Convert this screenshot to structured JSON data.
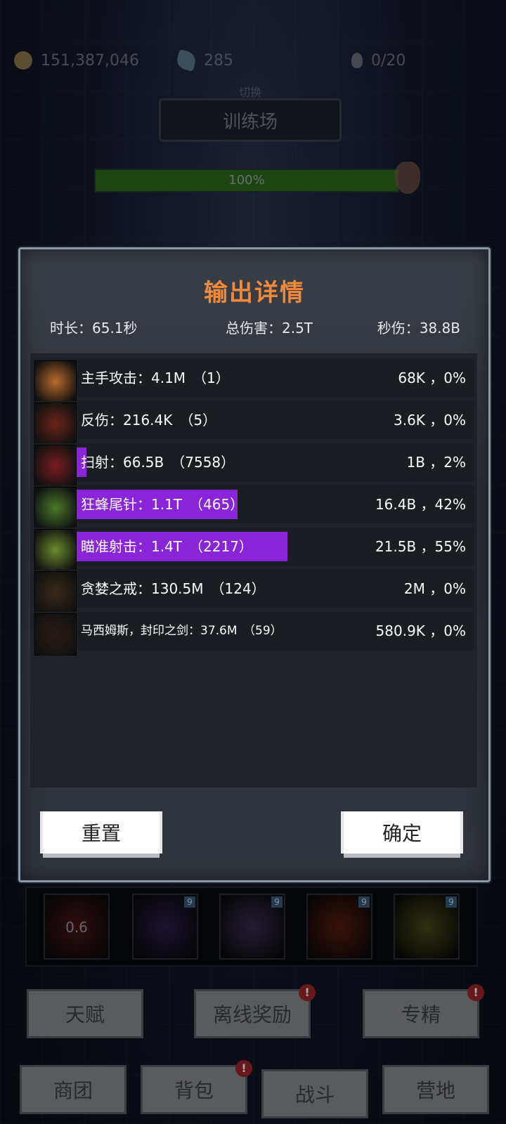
{
  "resources": {
    "gold": "151,387,046",
    "gems": "285",
    "stamina": "0/20"
  },
  "scene": {
    "switch_sub": "切换",
    "switch_label": "训练场",
    "hp_text": "100%"
  },
  "modal": {
    "title": "输出详情",
    "duration": "时长：65.1秒",
    "total_damage": "总伤害：2.5T",
    "dps": "秒伤：38.8B",
    "rows": [
      {
        "name": "主手攻击：4.1M　（1）",
        "right": "68K ，0%",
        "share": 0,
        "icon_color": "#b86a2a"
      },
      {
        "name": "反伤：216.4K　（5）",
        "right": "3.6K ，0%",
        "share": 0,
        "icon_color": "#6a2418"
      },
      {
        "name": "扫射：66.5B　（7558）",
        "right": "1B ，2%",
        "share": 2,
        "icon_color": "#7a1c22"
      },
      {
        "name": "狂蜂尾针：1.1T　（465）",
        "right": "16.4B ，42%",
        "share": 42,
        "icon_color": "#4a7a2a"
      },
      {
        "name": "瞄准射击：1.4T　（2217）",
        "right": "21.5B ，55%",
        "share": 55,
        "icon_color": "#6a8a2a"
      },
      {
        "name": "贪婪之戒：130.5M　（124）",
        "right": "2M ，0%",
        "share": 0,
        "icon_color": "#3a2a1a"
      },
      {
        "name": "马西姆斯，封印之剑：37.6M　（59）",
        "right": "580.9K ，0%",
        "share": 0,
        "icon_color": "#2a1c14"
      }
    ],
    "reset_label": "重置",
    "confirm_label": "确定"
  },
  "skills": [
    {
      "num": "0.6",
      "color": "#4a1418",
      "badge": ""
    },
    {
      "num": "",
      "color": "#2a1c4a",
      "badge": "9"
    },
    {
      "num": "",
      "color": "#3a2c50",
      "badge": "9"
    },
    {
      "num": "",
      "color": "#5a1a10",
      "badge": "9"
    },
    {
      "num": "",
      "color": "#4a4a18",
      "badge": "9"
    }
  ],
  "menu": {
    "talent": "天赋",
    "offline_reward": "离线奖励",
    "specialize": "专精",
    "guild": "商团",
    "bag": "背包",
    "battle": "战斗",
    "camp": "营地",
    "alert_mark": "!"
  },
  "colors": {
    "title": "#f08a3a",
    "damage_bar": "#8a24d8",
    "hp_bar": "#2c6a1d"
  }
}
